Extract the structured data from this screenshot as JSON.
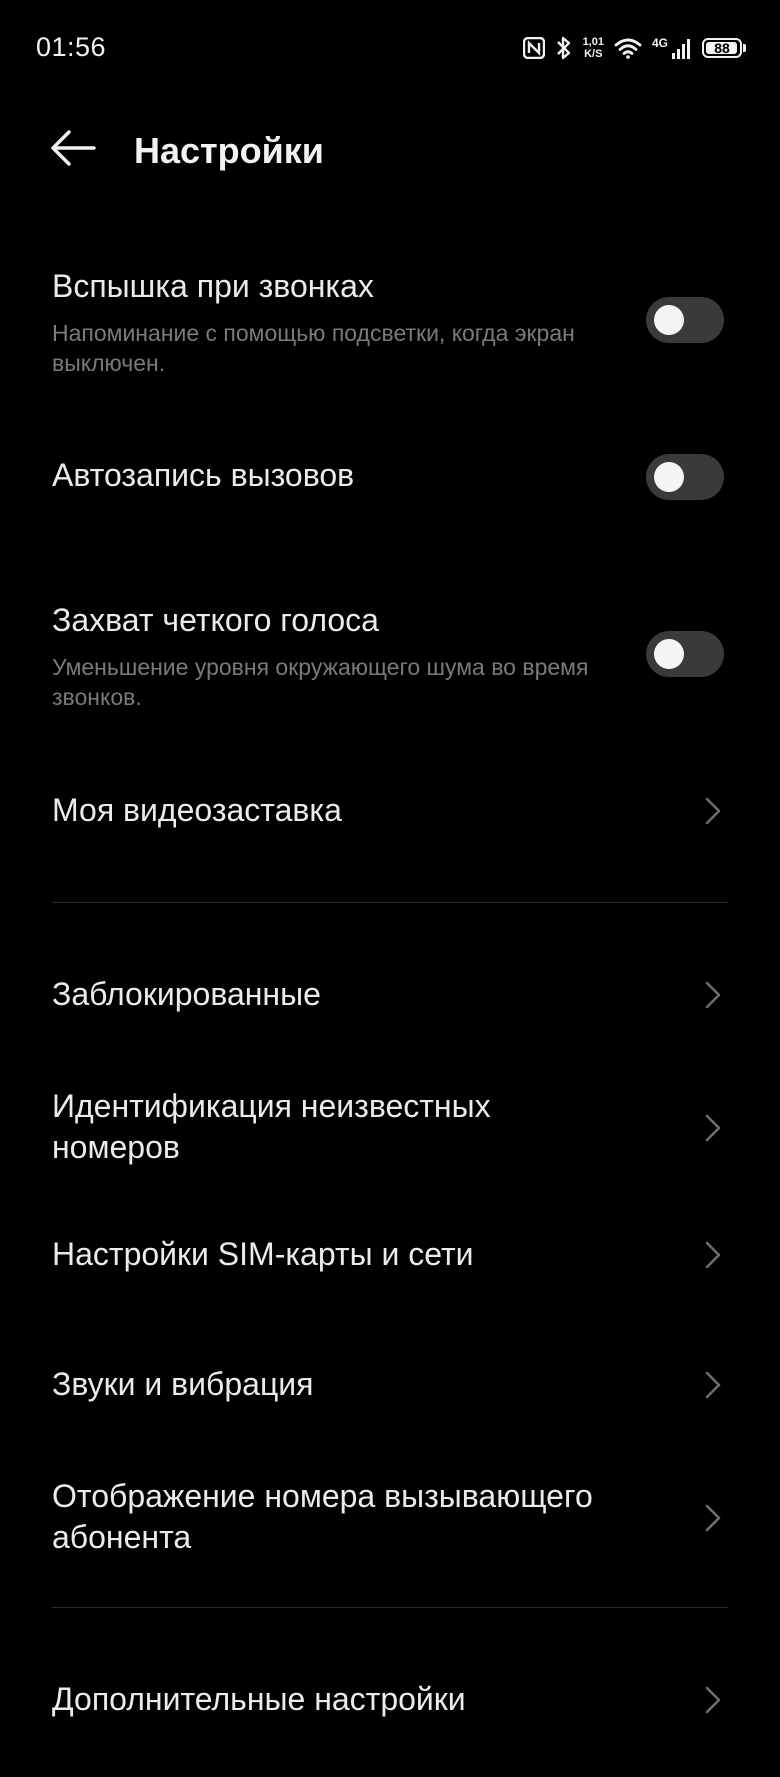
{
  "status_bar": {
    "time": "01:56",
    "speed_value": "1,01",
    "speed_unit": "K/S",
    "network": "4G",
    "battery": "88",
    "battery_level_percent": 88,
    "icons": [
      "nfc-icon",
      "bluetooth-icon",
      "wifi-icon",
      "signal-icon",
      "battery-icon"
    ]
  },
  "header": {
    "title": "Настройки",
    "back_icon": "arrow-left-icon"
  },
  "settings": {
    "flash": {
      "label": "Вспышка при звонках",
      "subtitle": "Напоминание с помощью подсветки, когда экран выключен.",
      "enabled": false
    },
    "autorecord": {
      "label": "Автозапись вызовов",
      "enabled": false
    },
    "clear_voice": {
      "label": "Захват четкого голоса",
      "subtitle": "Уменьшение уровня окружающего шума во время звонков.",
      "enabled": false
    },
    "video_ringtone": {
      "label": "Моя видеозаставка"
    },
    "blocked": {
      "label": "Заблокированные"
    },
    "unknown_numbers": {
      "label": "Идентификация неизвестных номеров"
    },
    "sim_network": {
      "label": "Настройки SIM-карты и сети"
    },
    "sounds": {
      "label": "Звуки и вибрация"
    },
    "caller_id": {
      "label": "Отображение номера вызывающего абонента"
    },
    "more": {
      "label": "Дополнительные настройки"
    }
  },
  "colors": {
    "background": "#000000",
    "text": "#ebebeb",
    "secondary_text": "#7a7a7a",
    "toggle_off": "#3a3a3a"
  }
}
